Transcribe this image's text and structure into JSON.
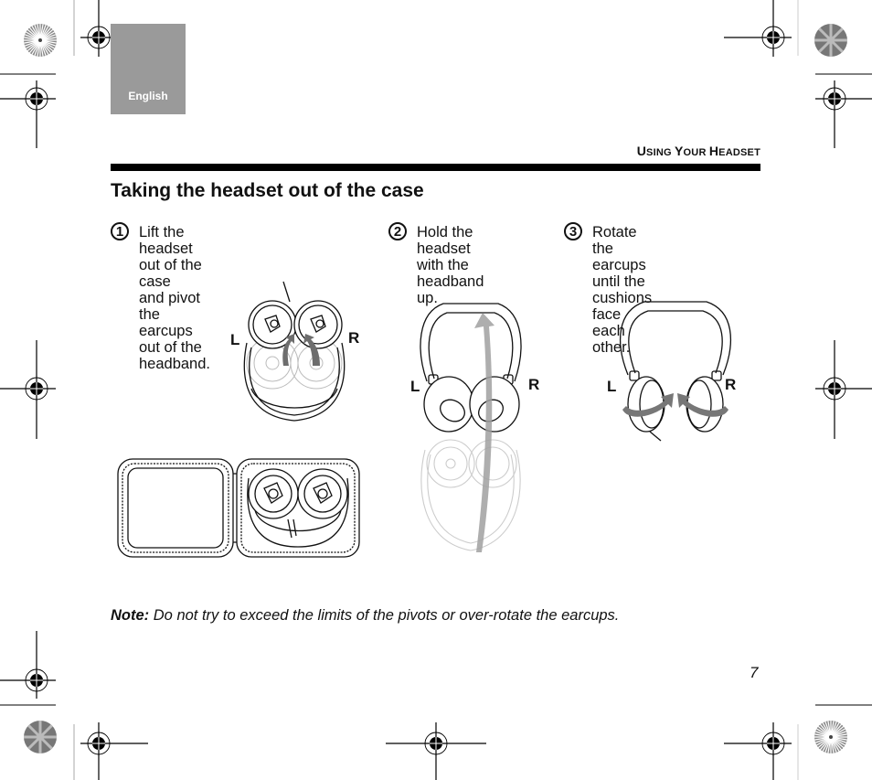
{
  "language_tab": {
    "label": "English"
  },
  "header": {
    "section_title_parts": [
      {
        "initial": "U",
        "rest": "SING "
      },
      {
        "initial": "Y",
        "rest": "OUR "
      },
      {
        "initial": "H",
        "rest": "EADSET"
      }
    ],
    "section_title": "Using Your Headset"
  },
  "page_title": "Taking the headset out of the case",
  "steps": [
    {
      "number": "1",
      "lines": [
        "Lift the headset out of the case",
        "and pivot the earcups out of the",
        "headband."
      ]
    },
    {
      "number": "2",
      "lines": [
        "Hold the",
        "headset with the",
        "headband up."
      ]
    },
    {
      "number": "3",
      "lines": [
        "Rotate the earcups",
        "until the cushions face",
        "each other."
      ]
    }
  ],
  "illustrations": {
    "step1_labels": {
      "left": "L",
      "right": "R"
    },
    "step2_labels": {
      "left": "L",
      "right": "R"
    },
    "step3_labels": {
      "left": "L",
      "right": "R"
    }
  },
  "note": {
    "label": "Note:",
    "text": "Do not try to exceed the limits of the pivots or over-rotate the earcups."
  },
  "page_number": "7"
}
